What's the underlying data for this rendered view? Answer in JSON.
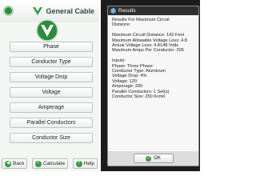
{
  "brand": {
    "name": "General Cable"
  },
  "menu": {
    "items": [
      "Phase",
      "Conductor Type",
      "Voltage Drop",
      "Voltage",
      "Amperage",
      "Parallel Conductors",
      "Conductor Size"
    ]
  },
  "nav": {
    "back": "Back",
    "calculate": "Calculate",
    "help": "Help"
  },
  "dialog": {
    "title": "Results",
    "lines": [
      "Results For Maximum Circuit",
      "Distance:",
      "",
      "Maximum Circuit Distance: 142 Feet",
      "Maximum Allowable Voltage Loss: 4.8",
      "Actual Voltage Loss: 4.8148 Volts",
      "Maximum Amps Per Conductor: 205",
      "",
      "Inputs:",
      "Phase: Three Phase",
      "Conductor Type: Aluminum",
      "Voltage Drop: 4%",
      "Voltage: 120",
      "Amperage: 200",
      "Parallel Conductors: 1 Set(s)",
      "Conductor Size: 250 Kcmil"
    ],
    "ok_label": "OK"
  },
  "colors": {
    "brand_green": "#2e8b3e",
    "dialog_title_bg": "#2f2f2f"
  }
}
